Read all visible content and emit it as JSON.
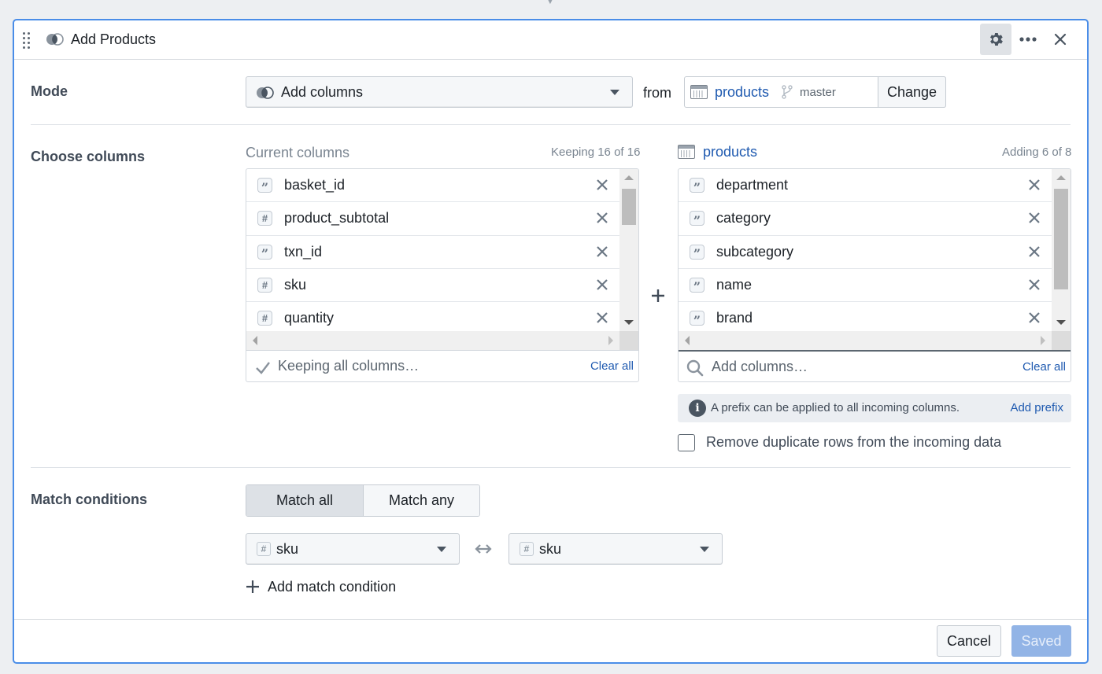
{
  "header": {
    "title": "Add Products",
    "icons": [
      "drag-handle-icon",
      "join-icon",
      "gear-icon",
      "more-icon",
      "close-icon"
    ]
  },
  "mode": {
    "label": "Mode",
    "selected": "Add columns",
    "from_label": "from",
    "source": {
      "name": "products",
      "branch": "master"
    },
    "change_label": "Change"
  },
  "choose_columns": {
    "label": "Choose columns",
    "current": {
      "heading": "Current columns",
      "count": "Keeping 16 of 16",
      "rows": [
        {
          "type": "string",
          "name": "basket_id"
        },
        {
          "type": "number",
          "name": "product_subtotal"
        },
        {
          "type": "string",
          "name": "txn_id"
        },
        {
          "type": "number",
          "name": "sku"
        },
        {
          "type": "number",
          "name": "quantity"
        }
      ],
      "footer_text": "Keeping all columns…",
      "clear_all": "Clear all"
    },
    "incoming": {
      "heading": "products",
      "count": "Adding 6 of 8",
      "rows": [
        {
          "type": "string",
          "name": "department"
        },
        {
          "type": "string",
          "name": "category"
        },
        {
          "type": "string",
          "name": "subcategory"
        },
        {
          "type": "string",
          "name": "name"
        },
        {
          "type": "string",
          "name": "brand"
        }
      ],
      "search_placeholder": "Add columns…",
      "clear_all": "Clear all"
    },
    "prefix_callout": "A prefix can be applied to all incoming columns.",
    "add_prefix": "Add prefix",
    "dedupe_label": "Remove duplicate rows from the incoming data",
    "dedupe_checked": false
  },
  "match_conditions": {
    "label": "Match conditions",
    "modes": [
      "Match all",
      "Match any"
    ],
    "active_mode": "Match all",
    "conditions": [
      {
        "left": "sku",
        "right": "sku"
      }
    ],
    "add_label": "Add match condition"
  },
  "footer": {
    "cancel": "Cancel",
    "saved": "Saved"
  },
  "colors": {
    "accent": "#4a8de8",
    "link": "#1f5ab0",
    "primary_disabled": "#92b4e6"
  }
}
